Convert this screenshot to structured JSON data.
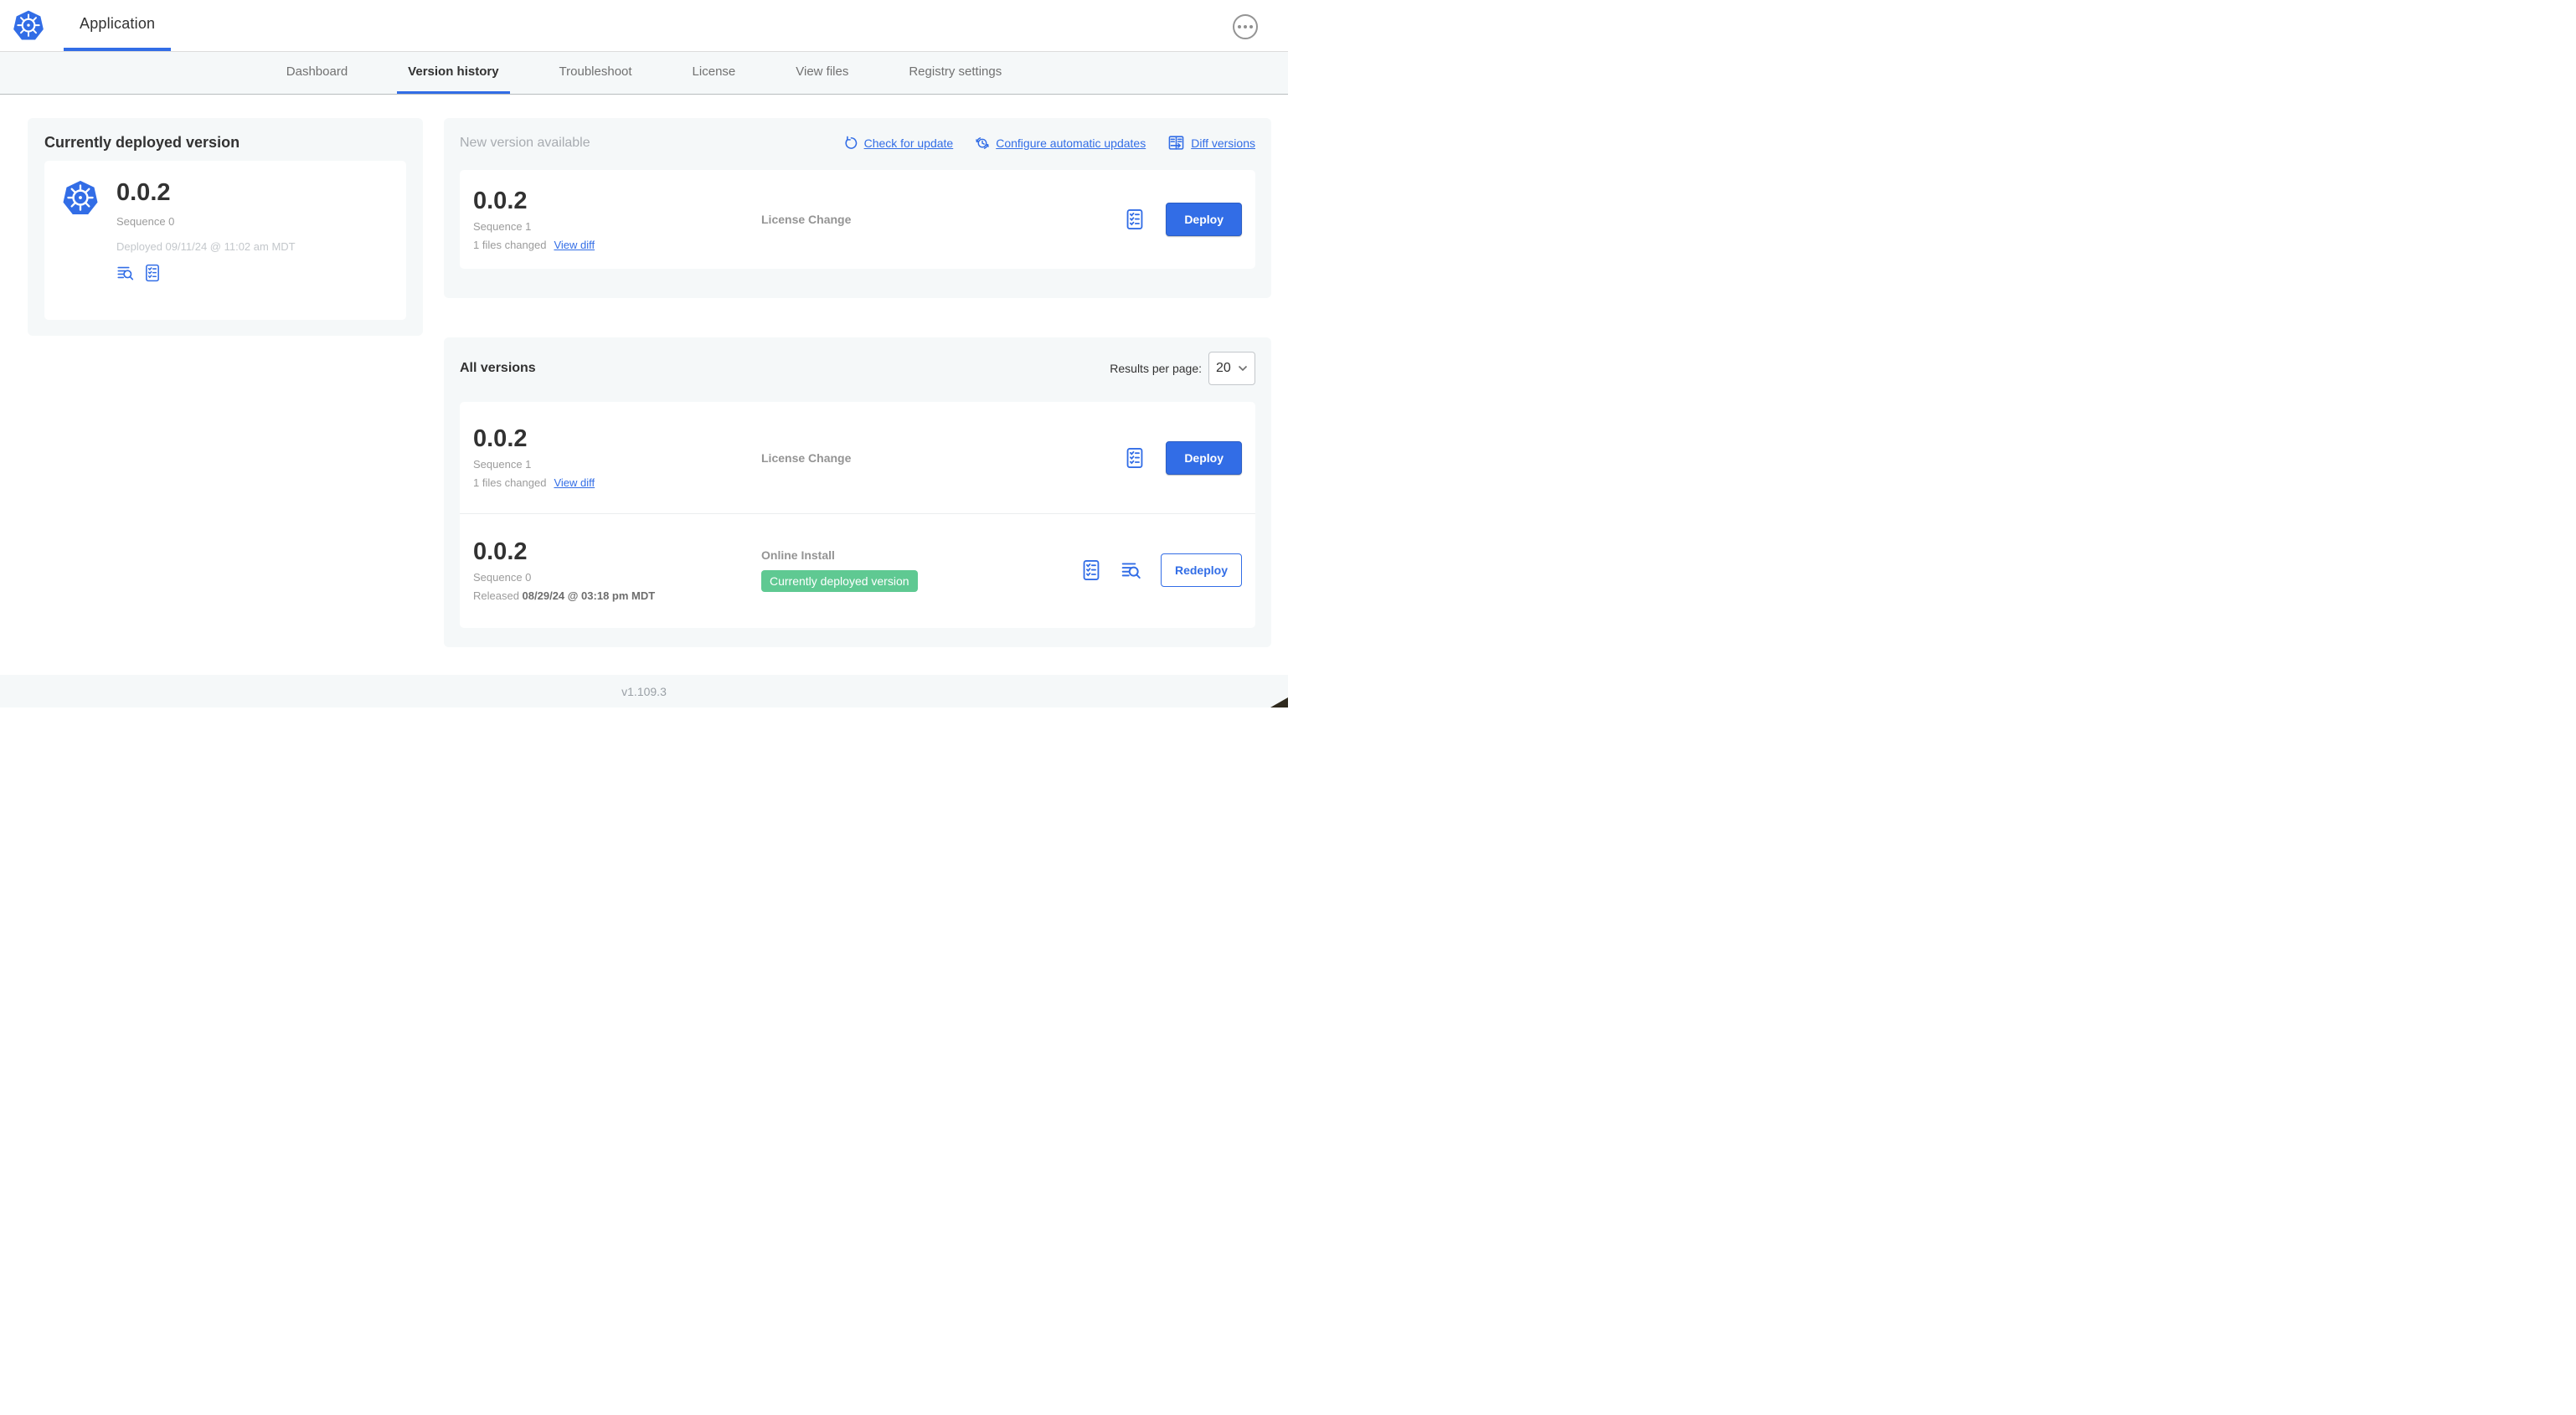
{
  "header": {
    "app_tab_label": "Application"
  },
  "nav": {
    "tabs": [
      {
        "label": "Dashboard",
        "active": false
      },
      {
        "label": "Version history",
        "active": true
      },
      {
        "label": "Troubleshoot",
        "active": false
      },
      {
        "label": "License",
        "active": false
      },
      {
        "label": "View files",
        "active": false
      },
      {
        "label": "Registry settings",
        "active": false
      }
    ]
  },
  "current_version_panel": {
    "title": "Currently deployed version",
    "version": "0.0.2",
    "sequence": "Sequence 0",
    "deployed": "Deployed 09/11/24 @ 11:02 am MDT"
  },
  "new_version_panel": {
    "title": "New version available",
    "actions": {
      "check_for_update": "Check for update",
      "configure_automatic_updates": "Configure automatic updates",
      "diff_versions": "Diff versions"
    },
    "row": {
      "version": "0.0.2",
      "sequence": "Sequence 1",
      "files_changed": "1 files changed",
      "view_diff": "View diff",
      "source": "License Change",
      "deploy_label": "Deploy"
    }
  },
  "all_versions_panel": {
    "title": "All versions",
    "results_per_page_label": "Results per page:",
    "results_per_page_value": "20",
    "rows": [
      {
        "version": "0.0.2",
        "sequence": "Sequence 1",
        "files_changed": "1 files changed",
        "view_diff": "View diff",
        "source": "License Change",
        "action_label": "Deploy"
      },
      {
        "version": "0.0.2",
        "sequence": "Sequence 0",
        "released_prefix": "Released ",
        "released_date": "08/29/24 @ 03:18 pm MDT",
        "source": "Online Install",
        "badge": "Currently deployed version",
        "action_label": "Redeploy"
      }
    ]
  },
  "footer": {
    "app_version": "v1.109.3"
  },
  "colors": {
    "primary_blue": "#326DE6",
    "badge_green": "#5FC992",
    "panel_gray": "#F5F8F9"
  }
}
